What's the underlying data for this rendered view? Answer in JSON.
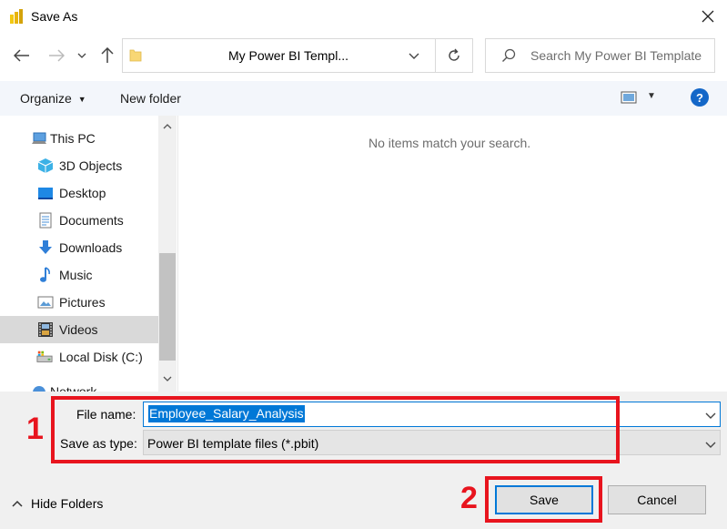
{
  "window": {
    "title": "Save As"
  },
  "address": {
    "path": "My Power BI Templ...",
    "search_placeholder": "Search My Power BI Template"
  },
  "toolbar": {
    "organize_label": "Organize",
    "new_folder_label": "New folder",
    "help_label": "?"
  },
  "nav": {
    "items": [
      {
        "label": "This PC",
        "icon": "computer-icon"
      },
      {
        "label": "3D Objects",
        "icon": "cube-icon"
      },
      {
        "label": "Desktop",
        "icon": "desktop-icon"
      },
      {
        "label": "Documents",
        "icon": "documents-icon"
      },
      {
        "label": "Downloads",
        "icon": "download-arrow-icon"
      },
      {
        "label": "Music",
        "icon": "music-note-icon"
      },
      {
        "label": "Pictures",
        "icon": "pictures-icon"
      },
      {
        "label": "Videos",
        "icon": "film-icon",
        "selected": true
      },
      {
        "label": "Local Disk (C:)",
        "icon": "drive-icon"
      },
      {
        "label": "Network",
        "icon": "network-icon"
      }
    ]
  },
  "content": {
    "empty_message": "No items match your search."
  },
  "form": {
    "file_name_label": "File name:",
    "file_name_value": "Employee_Salary_Analysis",
    "save_type_label": "Save as type:",
    "save_type_value": "Power BI template files (*.pbit)"
  },
  "footer": {
    "hide_folders_label": "Hide Folders",
    "save_label": "Save",
    "cancel_label": "Cancel"
  },
  "annotations": {
    "step1": "1",
    "step2": "2"
  },
  "colors": {
    "accent": "#0078d7",
    "annotation": "#e8141e",
    "help": "#1467c8",
    "selected": "#d9d9d9"
  }
}
